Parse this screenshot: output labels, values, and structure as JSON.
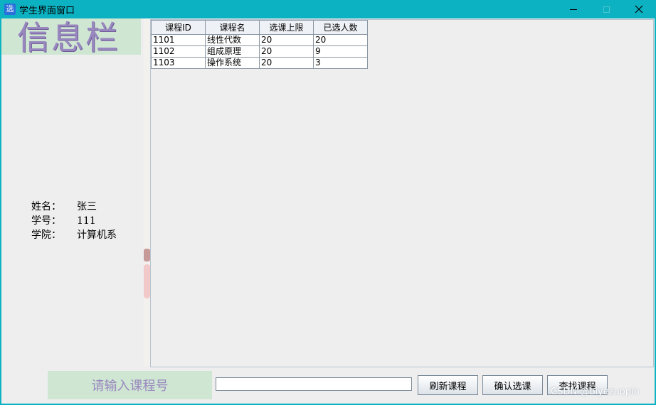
{
  "window": {
    "app_icon_text": "选",
    "title": "学生界面窗口"
  },
  "info_panel": {
    "banner": "信息栏",
    "name_label": "姓名：",
    "name_value": "张三",
    "id_label": "学号：",
    "id_value": "111",
    "college_label": "学院：",
    "college_value": "计算机系"
  },
  "table": {
    "columns": [
      "课程ID",
      "课程名",
      "选课上限",
      "已选人数"
    ],
    "rows": [
      [
        "1101",
        "线性代数",
        "20",
        "20"
      ],
      [
        "1102",
        "组成原理",
        "20",
        "9"
      ],
      [
        "1103",
        "操作系统",
        "20",
        "3"
      ]
    ]
  },
  "bottom": {
    "prompt_label": "请输入课程号",
    "input_value": "",
    "refresh_button": "刷新课程",
    "confirm_button": "确认选课",
    "search_button": "查找课程"
  },
  "watermark": "CSDN @biyezuopin",
  "colors": {
    "titlebar": "#0db2c2",
    "banner_bg": "#cfe6d3",
    "banner_text": "#9987bf"
  }
}
